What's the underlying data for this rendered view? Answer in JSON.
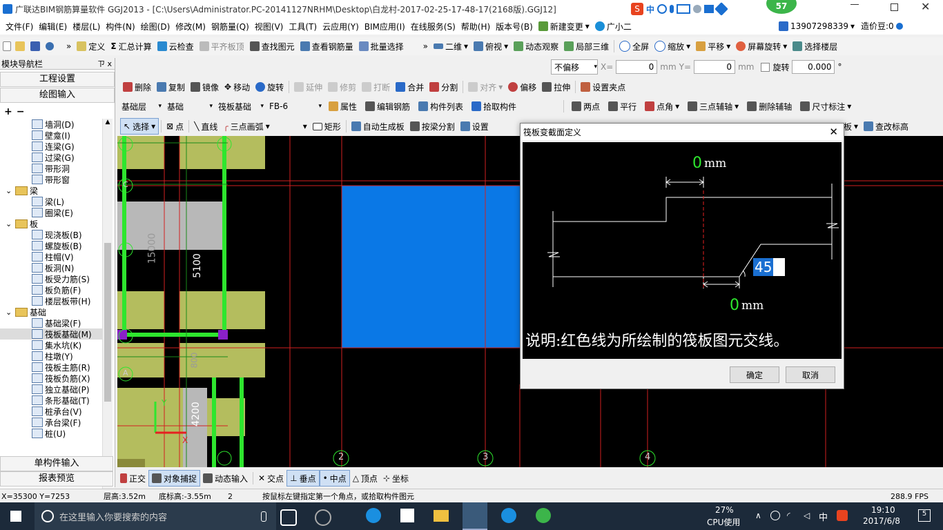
{
  "titlebar": {
    "title": "广联达BIM钢筋算量软件 GGJ2013 - [C:\\Users\\Administrator.PC-20141127NRHM\\Desktop\\白龙村-2017-02-25-17-48-17(2168版).GGJ12]",
    "ime_label": "中",
    "badge": "57"
  },
  "menubar": {
    "items": [
      "文件(F)",
      "编辑(E)",
      "楼层(L)",
      "构件(N)",
      "绘图(D)",
      "修改(M)",
      "钢筋量(Q)",
      "视图(V)",
      "工具(T)",
      "云应用(Y)",
      "BIM应用(I)",
      "在线服务(S)",
      "帮助(H)",
      "版本号(B)"
    ],
    "new_change": "新建变更",
    "assistant": "广小二",
    "phone": "13907298339",
    "price": "造价豆:0"
  },
  "toolbar1": {
    "items": [
      "定义",
      "汇总计算",
      "云检查",
      "平齐板顶",
      "查找图元",
      "查看钢筋量",
      "批量选择"
    ],
    "view_items": [
      "二维",
      "俯视",
      "动态观察",
      "局部三维",
      "全屏",
      "缩放",
      "平移",
      "屏幕旋转",
      "选择楼层"
    ]
  },
  "offset_bar": {
    "offset_mode": "不偏移",
    "x_label": "X=",
    "x_value": "0",
    "mm1": "mm",
    "y_label": "Y=",
    "y_value": "0",
    "mm2": "mm",
    "rotate_label": "旋转",
    "rotate_value": "0.000",
    "degree": "°"
  },
  "toolbar2": {
    "items": [
      "删除",
      "复制",
      "镜像",
      "移动",
      "旋转",
      "延伸",
      "修剪",
      "打断",
      "合并",
      "分割",
      "对齐",
      "偏移",
      "拉伸",
      "设置夹点"
    ]
  },
  "toolbar3": {
    "layer": "基础层",
    "category": "基础",
    "type": "筏板基础",
    "name": "FB-6",
    "items": [
      "属性",
      "编辑钢筋",
      "构件列表",
      "拾取构件"
    ],
    "aux": [
      "两点",
      "平行",
      "点角",
      "三点辅轴",
      "删除辅轴",
      "尺寸标注"
    ]
  },
  "toolbar4": {
    "items": [
      "选择",
      "点",
      "直线",
      "三点画弧",
      "矩形",
      "自动生成板",
      "按梁分割",
      "设置"
    ],
    "right": [
      "板",
      "查改标高"
    ]
  },
  "sidebar": {
    "title": "模块导航栏",
    "pin": "ㄗ x",
    "sections": [
      "工程设置",
      "绘图输入"
    ],
    "bottom": [
      "单构件输入",
      "报表预览"
    ],
    "tree": [
      {
        "label": "墙洞(D)",
        "level": 2
      },
      {
        "label": "壁龛(I)",
        "level": 2
      },
      {
        "label": "连梁(G)",
        "level": 2
      },
      {
        "label": "过梁(G)",
        "level": 2
      },
      {
        "label": "带形洞",
        "level": 2
      },
      {
        "label": "带形窗",
        "level": 2
      },
      {
        "label": "梁",
        "level": 1
      },
      {
        "label": "梁(L)",
        "level": 2
      },
      {
        "label": "圈梁(E)",
        "level": 2
      },
      {
        "label": "板",
        "level": 1
      },
      {
        "label": "现浇板(B)",
        "level": 2
      },
      {
        "label": "螺旋板(B)",
        "level": 2
      },
      {
        "label": "柱帽(V)",
        "level": 2
      },
      {
        "label": "板洞(N)",
        "level": 2
      },
      {
        "label": "板受力筋(S)",
        "level": 2
      },
      {
        "label": "板负筋(F)",
        "level": 2
      },
      {
        "label": "楼层板带(H)",
        "level": 2
      },
      {
        "label": "基础",
        "level": 1
      },
      {
        "label": "基础梁(F)",
        "level": 2
      },
      {
        "label": "筏板基础(M)",
        "level": 2
      },
      {
        "label": "集水坑(K)",
        "level": 2
      },
      {
        "label": "柱墩(Y)",
        "level": 2
      },
      {
        "label": "筏板主筋(R)",
        "level": 2
      },
      {
        "label": "筏板负筋(X)",
        "level": 2
      },
      {
        "label": "独立基础(P)",
        "level": 2
      },
      {
        "label": "条形基础(T)",
        "level": 2
      },
      {
        "label": "桩承台(V)",
        "level": 2
      },
      {
        "label": "承台梁(F)",
        "level": 2
      },
      {
        "label": "桩(U)",
        "level": 2
      }
    ]
  },
  "canvas": {
    "dims": [
      "15000",
      "5100",
      "4200",
      "800"
    ],
    "axis_left": [
      "C",
      "A"
    ],
    "axis_bottom": [
      "2",
      "3",
      "4"
    ],
    "axis_y_label": "Y",
    "axis_x_label": "X"
  },
  "dialog": {
    "title": "筏板变截面定义",
    "top_value": "0",
    "top_unit": "mm",
    "angle_value": "45",
    "bottom_value": "0",
    "bottom_unit": "mm",
    "note": "说明:红色线为所绘制的筏板图元交线。",
    "ok": "确定",
    "cancel": "取消"
  },
  "snapbar": {
    "items": [
      "正交",
      "对象捕捉",
      "动态输入",
      "交点",
      "垂点",
      "中点",
      "顶点",
      "坐标"
    ]
  },
  "statusbar": {
    "coords": "X=35300 Y=7253",
    "floor_height": "层高:3.52m",
    "base_height": "底标高:-3.55m",
    "count": "2",
    "hint": "按鼠标左键指定第一个角点，或拾取构件图元",
    "fps": "288.9 FPS"
  },
  "taskbar": {
    "search_placeholder": "在这里输入你要搜索的内容",
    "cpu_value": "27%",
    "cpu_label": "CPU使用",
    "ime": "中",
    "time": "19:10",
    "date": "2017/6/8",
    "notifications": "5"
  },
  "colors": {
    "canvas_bg": "#000000",
    "slab_blue": "#0a78e6",
    "slab_olive": "#b4bd5e",
    "grid_red": "#d22020",
    "beam_green": "#2ee62e"
  }
}
